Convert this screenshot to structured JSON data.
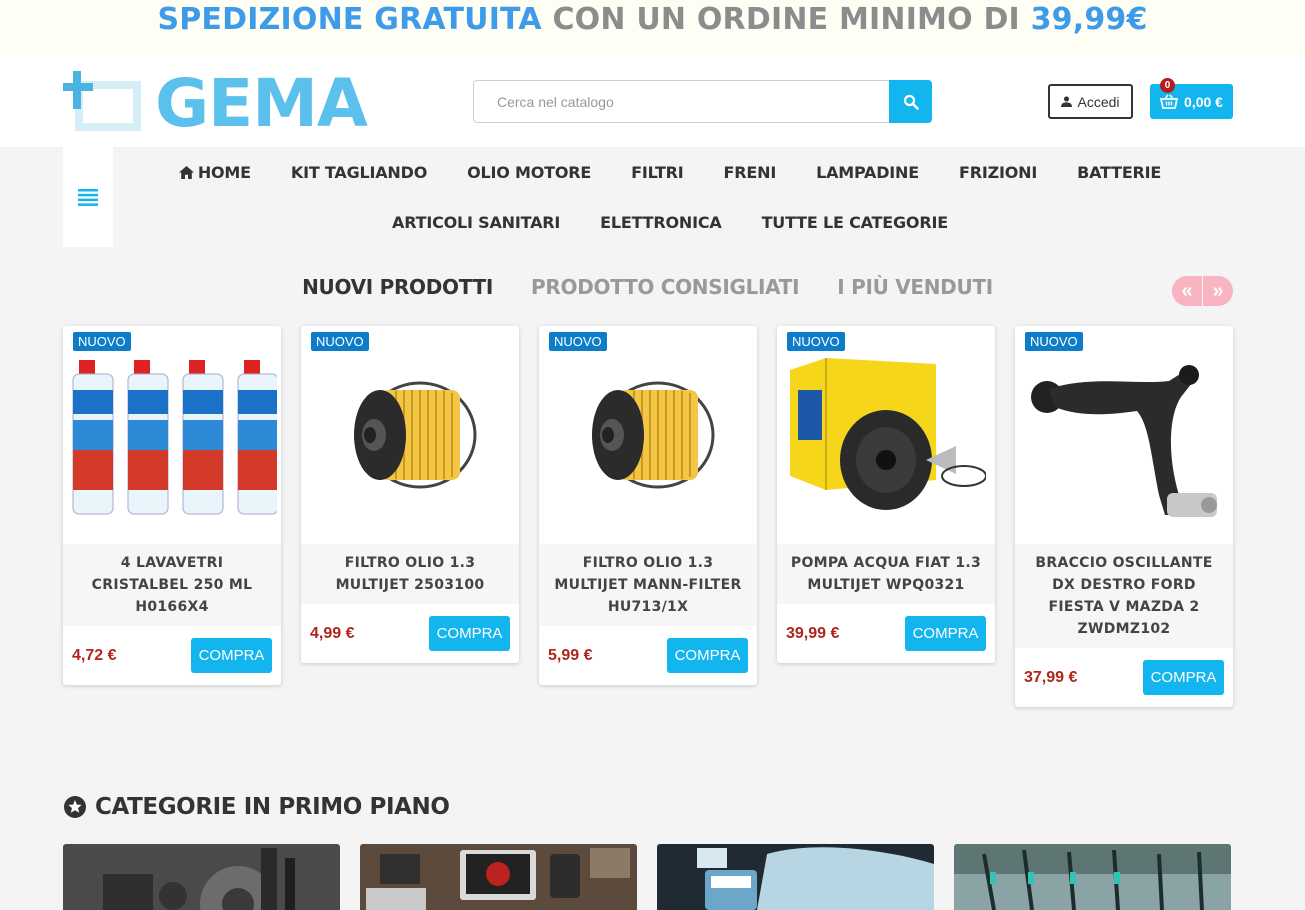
{
  "promo": {
    "part1": "SPEDIZIONE GRATUITA",
    "part2": "CON UN ORDINE MINIMO DI",
    "part3": "39,99€"
  },
  "header": {
    "logo_text": "GEMA",
    "search_placeholder": "Cerca nel catalogo",
    "login_label": "Accedi",
    "cart_count": "0",
    "cart_total": "0,00 €"
  },
  "nav": {
    "row1": [
      "HOME",
      "KIT TAGLIANDO",
      "OLIO MOTORE",
      "FILTRI",
      "FRENI",
      "LAMPADINE",
      "FRIZIONI",
      "BATTERIE"
    ],
    "row2": [
      "ARTICOLI SANITARI",
      "ELETTRONICA",
      "TUTTE LE CATEGORIE"
    ]
  },
  "tabs": [
    "NUOVI PRODOTTI",
    "PRODOTTO CONSIGLIATI",
    "I PIÙ VENDUTI"
  ],
  "products": [
    {
      "badge": "NUOVO",
      "title": "4 LAVAVETRI CRISTALBEL 250 ML H0166X4",
      "price": "4,72 €",
      "buy": "COMPRA",
      "image": "windshield-washer-bottles"
    },
    {
      "badge": "NUOVO",
      "title": "FILTRO OLIO 1.3 MULTIJET 2503100",
      "price": "4,99 €",
      "buy": "COMPRA",
      "image": "oil-filter"
    },
    {
      "badge": "NUOVO",
      "title": "FILTRO OLIO 1.3 MULTIJET MANN-FILTER HU713/1X",
      "price": "5,99 €",
      "buy": "COMPRA",
      "image": "oil-filter"
    },
    {
      "badge": "NUOVO",
      "title": "POMPA ACQUA FIAT 1.3 MULTIJET WPQ0321",
      "price": "39,99 €",
      "buy": "COMPRA",
      "image": "water-pump"
    },
    {
      "badge": "NUOVO",
      "title": "BRACCIO OSCILLANTE DX DESTRO FORD FIESTA V MAZDA 2 ZWDMZ102",
      "price": "37,99 €",
      "buy": "COMPRA",
      "image": "control-arm"
    }
  ],
  "featured": {
    "title": "CATEGORIE IN PRIMO PIANO"
  },
  "colors": {
    "accent": "#13b5ee",
    "price": "#b0261a",
    "badge": "#0e7dc9",
    "promo_blue": "#3d9bea"
  }
}
